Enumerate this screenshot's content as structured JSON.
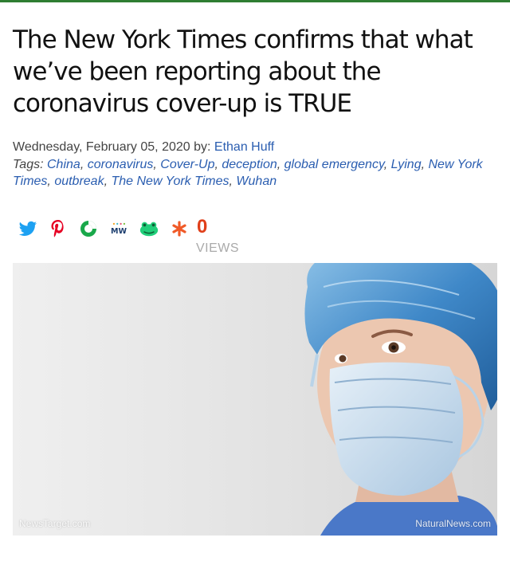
{
  "article": {
    "headline": "The New York Times confirms that what we’ve been reporting about the coronavirus cover-up is TRUE",
    "date": "Wednesday, February 05, 2020",
    "by_label": "by:",
    "author": "Ethan Huff",
    "tags_label": "Tags:",
    "tags": [
      "China",
      "coronavirus",
      "Cover-Up",
      "deception",
      "global emergency",
      "Lying",
      "New York Times",
      "outbreak",
      "The New York Times",
      "Wuhan"
    ]
  },
  "share": {
    "icons": [
      "twitter-icon",
      "pinterest-icon",
      "brighteon-icon",
      "mewe-icon",
      "gab-icon",
      "favorite-icon"
    ],
    "views_count": "0",
    "views_label": "VIEWS"
  },
  "image": {
    "watermark_left": "NewsTarget.com",
    "watermark_right": "NaturalNews.com"
  },
  "colors": {
    "link": "#2a5db0",
    "views": "#e03f1a",
    "top_bar": "#2e7d32"
  }
}
